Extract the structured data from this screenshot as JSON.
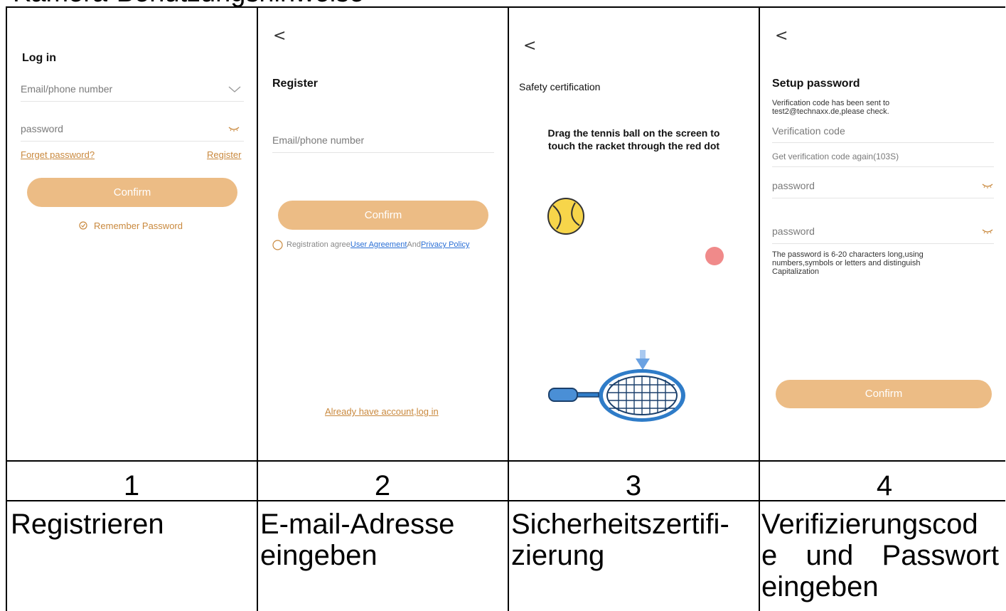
{
  "header": {
    "partial_text": "Kamera-Benutzungshinweise"
  },
  "panels": [
    {
      "title": "Log in",
      "email_placeholder": "Email/phone number",
      "password_placeholder": "password",
      "forget_link": "Forget password?",
      "register_link": "Register",
      "confirm_label": "Confirm",
      "remember_label": "Remember Password"
    },
    {
      "back_glyph": "<",
      "title": "Register",
      "email_placeholder": "Email/phone number",
      "confirm_label": "Confirm",
      "agree_prefix": "Registration agree",
      "user_agreement": "User Agreement",
      "and_text": "And",
      "privacy_policy": "Privacy Policy",
      "login_link": "Already have account,log in"
    },
    {
      "back_glyph": "<",
      "title": "Safety certification",
      "instruction_line1": "Drag the tennis ball on the screen to",
      "instruction_line2": "touch the racket through the red dot"
    },
    {
      "back_glyph": "<",
      "title": "Setup password",
      "sent_line1": "Verification code has been sent to",
      "sent_line2": "test2@technaxx.de,please check.",
      "code_placeholder": "Verification code",
      "resend_label": "Get verification code again(103S)",
      "password_placeholder": "password",
      "password2_placeholder": "password",
      "rule_line1": "The password is 6-20 characters long,using",
      "rule_line2": "numbers,symbols or letters and distinguish",
      "rule_line3": "Capitalization",
      "confirm_label": "Confirm"
    }
  ],
  "step_numbers": [
    "1",
    "2",
    "3",
    "4"
  ],
  "captions": [
    {
      "line1": "Registrieren",
      "line2": "",
      "line3": ""
    },
    {
      "line1": "E-mail-Adresse",
      "line2": "eingeben",
      "line3": ""
    },
    {
      "line1": "Sicherheitszertifi-",
      "line2": "zierung",
      "line3": ""
    },
    {
      "line1": "Verifizierungscod",
      "line2": "e und Passwort",
      "line3": "eingeben"
    }
  ],
  "colors": {
    "accent_orange": "#ecbc85",
    "link_orange": "#c9893e",
    "link_blue": "#2a6fd6",
    "tennis_ball": "#f7d54a",
    "red_dot": "#f08a8a",
    "racket_blue": "#2f7cc8"
  },
  "icons": [
    "chevron-down-icon",
    "eye-closed-icon",
    "check-circle-icon",
    "radio-circle-icon",
    "back-arrow-icon",
    "tennis-ball-icon",
    "red-dot-icon",
    "down-arrow-icon",
    "tennis-racket-icon"
  ]
}
